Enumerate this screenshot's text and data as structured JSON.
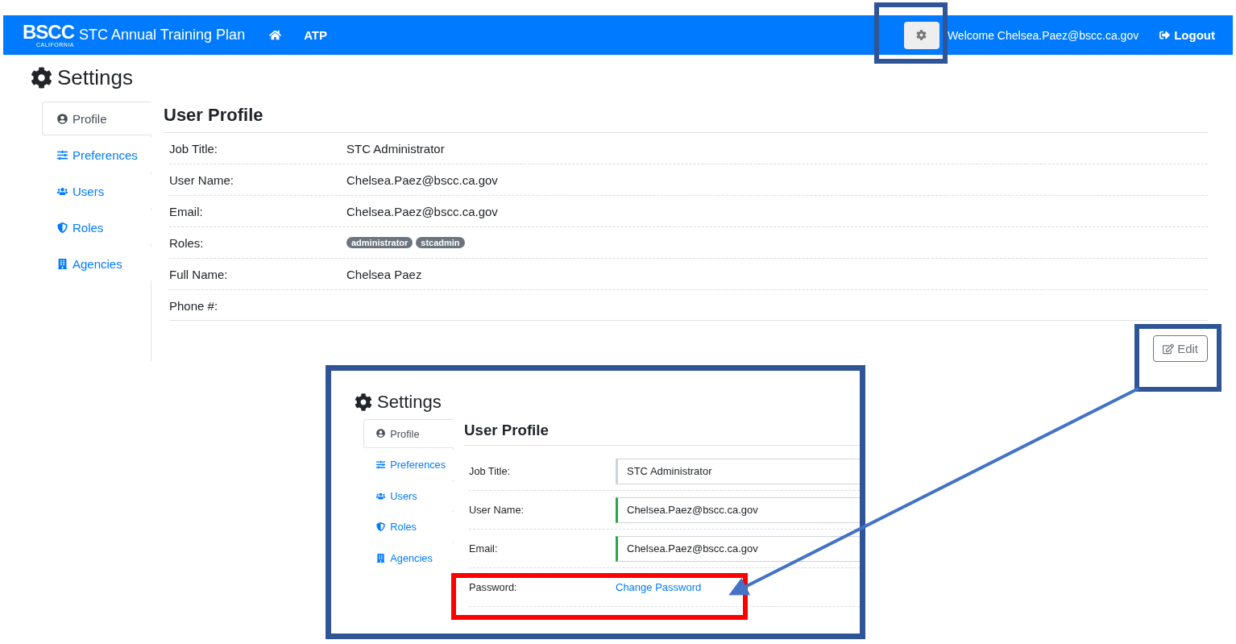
{
  "navbar": {
    "logo": "BSCC",
    "logo_sub": "CALIFORNIA",
    "title": "STC Annual Training Plan",
    "links": [
      "ATP"
    ],
    "welcome": "Welcome Chelsea.Paez@bscc.ca.gov",
    "logout": "Logout"
  },
  "page_title": "Settings",
  "tabs": [
    {
      "label": "Profile",
      "selected": true
    },
    {
      "label": "Preferences",
      "selected": false
    },
    {
      "label": "Users",
      "selected": false
    },
    {
      "label": "Roles",
      "selected": false
    },
    {
      "label": "Agencies",
      "selected": false
    }
  ],
  "profile": {
    "title": "User Profile",
    "fields": [
      {
        "label": "Job Title:",
        "value": "STC Administrator"
      },
      {
        "label": "User Name:",
        "value": "Chelsea.Paez@bscc.ca.gov"
      },
      {
        "label": "Email:",
        "value": "Chelsea.Paez@bscc.ca.gov"
      },
      {
        "label": "Roles:",
        "badges": [
          "administrator",
          "stcadmin"
        ]
      },
      {
        "label": "Full Name:",
        "value": "Chelsea Paez"
      },
      {
        "label": "Phone #:"
      }
    ]
  },
  "edit_button": "Edit",
  "inset": {
    "page_title": "Settings",
    "tabs": [
      {
        "label": "Profile",
        "selected": true
      },
      {
        "label": "Preferences",
        "selected": false
      },
      {
        "label": "Users",
        "selected": false
      },
      {
        "label": "Roles",
        "selected": false
      },
      {
        "label": "Agencies",
        "selected": false
      }
    ],
    "title": "User Profile",
    "fields": [
      {
        "kind": "input",
        "label": "Job Title:",
        "value": "STC Administrator",
        "valid": false
      },
      {
        "kind": "input",
        "label": "User Name:",
        "value": "Chelsea.Paez@bscc.ca.gov",
        "valid": true
      },
      {
        "kind": "input",
        "label": "Email:",
        "value": "Chelsea.Paez@bscc.ca.gov",
        "valid": true
      },
      {
        "kind": "link",
        "label": "Password:",
        "link": "Change Password"
      }
    ]
  }
}
